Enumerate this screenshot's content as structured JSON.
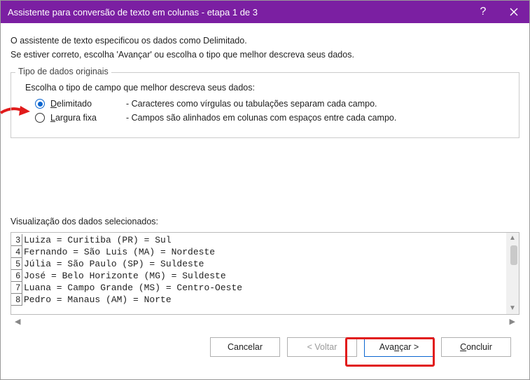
{
  "titlebar": {
    "title": "Assistente para conversão de texto em colunas - etapa 1 de 3"
  },
  "intro": {
    "line1": "O assistente de texto especificou os dados como Delimitado.",
    "line2": "Se estiver correto, escolha 'Avançar' ou escolha o tipo que melhor descreva seus dados."
  },
  "group": {
    "legend": "Tipo de dados originais",
    "choose": "Escolha o tipo de campo que melhor descreva seus dados:",
    "options": [
      {
        "label_pre": "D",
        "label_rest": "elimitado",
        "desc": "- Caracteres como vírgulas ou tabulações separam cada campo.",
        "checked": true
      },
      {
        "label_pre": "L",
        "label_rest": "argura fixa",
        "desc": "- Campos são alinhados em colunas com espaços entre cada campo.",
        "checked": false
      }
    ]
  },
  "preview": {
    "label": "Visualização dos dados selecionados:",
    "rows": [
      {
        "n": "3",
        "text": "Luiza = Curitiba (PR) = Sul"
      },
      {
        "n": "4",
        "text": "Fernando = São Luis (MA) = Nordeste"
      },
      {
        "n": "5",
        "text": "Júlia = São Paulo (SP) = Suldeste"
      },
      {
        "n": "6",
        "text": "José = Belo Horizonte (MG) = Suldeste"
      },
      {
        "n": "7",
        "text": "Luana = Campo Grande (MS) = Centro-Oeste"
      },
      {
        "n": "8",
        "text": "Pedro = Manaus (AM) = Norte"
      }
    ]
  },
  "buttons": {
    "cancel": "Cancelar",
    "back": "< Voltar",
    "next_pre": "Ava",
    "next_ul": "n",
    "next_post": "çar >",
    "finish_ul": "C",
    "finish_rest": "oncluir"
  }
}
